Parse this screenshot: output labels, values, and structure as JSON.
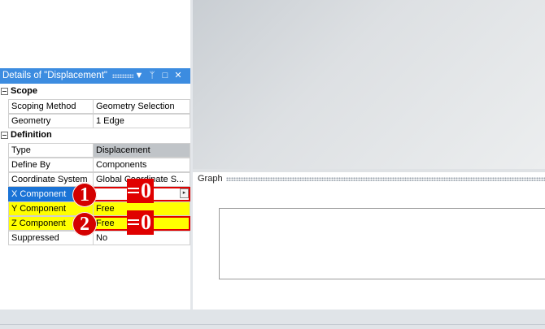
{
  "panel": {
    "title": "Details of \"Displacement\"",
    "buttons": {
      "dropdown": "▼",
      "pin": "ᛘ",
      "maximize": "□",
      "close": "✕"
    }
  },
  "categories": {
    "scope": "Scope",
    "definition": "Definition"
  },
  "rows": {
    "scoping_method": {
      "name": "Scoping Method",
      "value": "Geometry Selection"
    },
    "geometry": {
      "name": "Geometry",
      "value": "1 Edge"
    },
    "type": {
      "name": "Type",
      "value": "Displacement"
    },
    "define_by": {
      "name": "Define By",
      "value": "Components"
    },
    "coordinate_system": {
      "name": "Coordinate System",
      "value": "Global Coordinate S..."
    },
    "x_component": {
      "name": "X Component",
      "value": ""
    },
    "y_component": {
      "name": "Y Component",
      "value": "Free"
    },
    "z_component": {
      "name": "Z Component",
      "value": "Free"
    },
    "suppressed": {
      "name": "Suppressed",
      "value": "No"
    }
  },
  "annotations": {
    "marker1": "1",
    "marker2": "2",
    "zero1": "0",
    "zero2": "0"
  },
  "graph": {
    "title": "Graph"
  },
  "colors": {
    "title_bar": "#3c8ce0",
    "selected_row": "#1a73d6",
    "highlight_yellow": "#ffff00",
    "annotation_red": "#e00000"
  }
}
